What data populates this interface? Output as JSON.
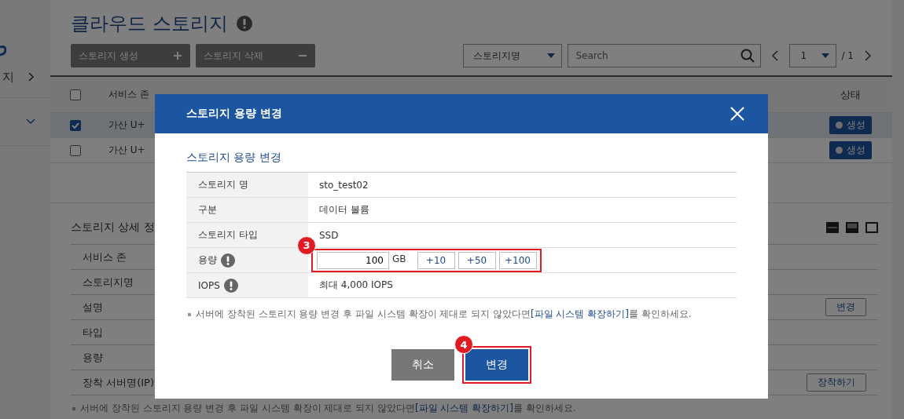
{
  "sidebar": {
    "items": [
      {
        "label": "지",
        "expanded": false
      },
      {
        "expanded": true
      }
    ]
  },
  "page": {
    "title": "클라우드 스토리지",
    "actions": [
      {
        "label": "스토리지 생성",
        "kind": "add"
      },
      {
        "label": "스토리지 삭제",
        "kind": "remove"
      }
    ],
    "filter": {
      "value": "스토리지명"
    },
    "search": {
      "placeholder": "Search"
    },
    "pager": {
      "page": "1",
      "total": "/ 1"
    }
  },
  "table": {
    "all_checked": false,
    "columns": [
      "서비스 존",
      "상태"
    ],
    "rows": [
      {
        "checked": true,
        "selected": true,
        "zone": "가산 U+",
        "status": "생성"
      },
      {
        "checked": false,
        "selected": false,
        "zone": "가산 U+",
        "status": "생성"
      }
    ]
  },
  "detail": {
    "title": "스토리지 상세 정",
    "rows": [
      {
        "label": "서비스 존"
      },
      {
        "label": "스토리지명"
      },
      {
        "label": "설명",
        "action": "변경"
      },
      {
        "label": "타입"
      },
      {
        "label": "용량"
      },
      {
        "label": "장착 서버명(IP)",
        "action": "장착하기"
      }
    ],
    "note": {
      "prefix": "서버에 장착된 스토리지 용량 변경 후 파일 시스템 확장이 제대로 되지 않았다면 ",
      "link": "[파일 시스템 확장하기]",
      "suffix": "를 확인하세요."
    }
  },
  "dialog": {
    "title": "스토리지 용량 변경",
    "subtitle": "스토리지 용량 변경",
    "rows": [
      {
        "kind": "text",
        "label": "스토리지 명",
        "info": false,
        "value": "sto_test02"
      },
      {
        "kind": "text",
        "label": "구분",
        "info": false,
        "value": "데이터 볼륨"
      },
      {
        "kind": "text",
        "label": "스토리지 타입",
        "info": false,
        "value": "SSD"
      },
      {
        "kind": "capacity",
        "label": "용량",
        "info": true,
        "value": "100",
        "unit": "GB",
        "steps": [
          "+10",
          "+50",
          "+100"
        ],
        "callout": "3"
      },
      {
        "kind": "text",
        "label": "IOPS",
        "info": true,
        "value": "최대 4,000 IOPS"
      }
    ],
    "note": {
      "prefix": "서버에 장착된 스토리지 용량 변경 후 파일 시스템 확장이 제대로 되지 않았다면 ",
      "link": "[파일 시스템 확장하기]",
      "suffix": "를 확인하세요."
    },
    "buttons": [
      {
        "label": "취소",
        "kind": "cancel"
      },
      {
        "label": "변경",
        "kind": "confirm",
        "callout": "4"
      }
    ]
  }
}
